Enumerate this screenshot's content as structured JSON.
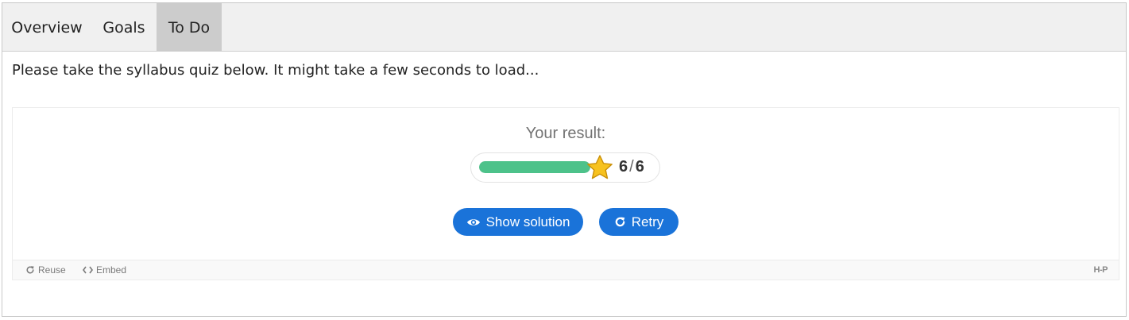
{
  "tabs": [
    {
      "label": "Overview",
      "active": false
    },
    {
      "label": "Goals",
      "active": false
    },
    {
      "label": "To Do",
      "active": true
    }
  ],
  "intro_text": "Please take the syllabus quiz below. It might take a few seconds to load...",
  "quiz": {
    "result_label": "Your result:",
    "score": "6",
    "max_score": "6",
    "score_separator": "/",
    "progress_fraction": 1.0,
    "buttons": {
      "show_solution": "Show solution",
      "retry": "Retry"
    },
    "footer": {
      "reuse": "Reuse",
      "embed": "Embed",
      "logo": "H-P"
    }
  },
  "colors": {
    "accent": "#1a73d9",
    "progress": "#4dc28a",
    "star": "#f7c21f",
    "tab_active": "#cccccc"
  },
  "icons": {
    "show_solution": "eye-icon",
    "retry": "refresh-icon",
    "reuse": "refresh-icon",
    "embed": "code-icon",
    "score": "star-icon"
  }
}
